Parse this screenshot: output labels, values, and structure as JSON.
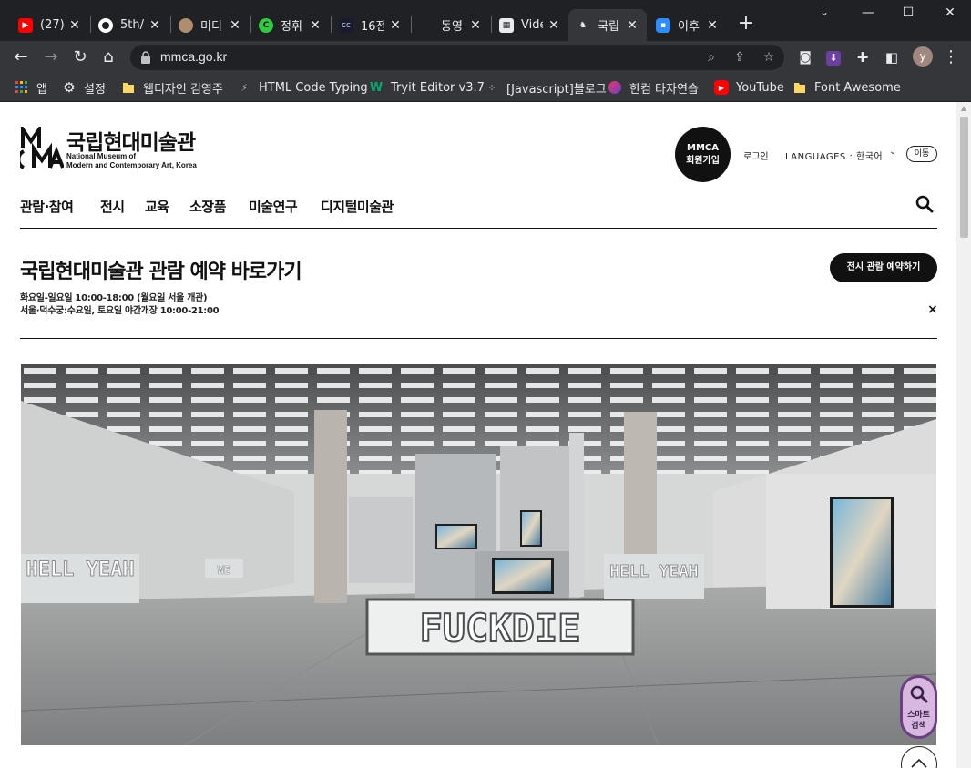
{
  "browser": {
    "tabs": [
      {
        "label": "(27)",
        "icon": "youtube-icon",
        "color": "#ff0000"
      },
      {
        "label": "5th/",
        "icon": "github-icon",
        "color": "#ffffff"
      },
      {
        "label": "미디",
        "icon": "avatar-icon",
        "color": "#b08d6e"
      },
      {
        "label": "정휘",
        "icon": "c-logo-icon",
        "color": "#2ecc40"
      },
      {
        "label": "16전",
        "icon": "cc-icon",
        "color": "#1a1a2e"
      },
      {
        "label": "동영",
        "icon": "blank-icon",
        "color": "#202124"
      },
      {
        "label": "Vide",
        "icon": "video-icon",
        "color": "#e8eaed"
      },
      {
        "label": "국립",
        "icon": "mmca-icon",
        "color": "#35363a"
      },
      {
        "label": "이후",
        "icon": "zoom-icon",
        "color": "#2d8cff"
      }
    ],
    "url": "mmca.go.kr",
    "avatar_letter": "y",
    "bookmarks": [
      {
        "label": "앱",
        "icon": "apps-grid-icon"
      },
      {
        "label": "설정",
        "icon": "gear-icon"
      },
      {
        "label": "웹디자인 김영주",
        "icon": "folder-icon"
      },
      {
        "label": "HTML Code Typing",
        "icon": "bolt-icon"
      },
      {
        "label": "Tryit Editor v3.7",
        "icon": "w-icon"
      },
      {
        "label": "[Javascript]블로그",
        "icon": "dots-icon"
      },
      {
        "label": "한컴 타자연습",
        "icon": "hancom-icon"
      },
      {
        "label": "YouTube",
        "icon": "youtube-icon"
      },
      {
        "label": "Font Awesome",
        "icon": "folder-icon"
      }
    ]
  },
  "site": {
    "logo_ko": "국립현대미술관",
    "logo_en_1": "National Museum of",
    "logo_en_2": "Modern and Contemporary Art, Korea",
    "member_line1": "MMCA",
    "member_line2": "회원가입",
    "login": "로그인",
    "languages": "LANGUAGES : 한국어",
    "go": "이동",
    "nav": [
      "관람·참여",
      "전시",
      "교육",
      "소장품",
      "미술연구",
      "디지털미술관"
    ]
  },
  "notice": {
    "title": "국립현대미술관 관람 예약 바로가기",
    "line1": "화요일-일요일 10:00-18:00 (월요일 서울 개관)",
    "line2": "서울·덕수궁:수요일, 토요일 야간개장 10:00-21:00",
    "reserve_button": "전시 관람 예약하기",
    "close": "×"
  },
  "hero": {
    "sign_left": "HELL YEAH",
    "sign_small": "WE",
    "sign_center": "FUCKDIE",
    "sign_right": "HELL YEAH"
  },
  "floating": {
    "smart_line1": "스마트",
    "smart_line2": "검색"
  }
}
